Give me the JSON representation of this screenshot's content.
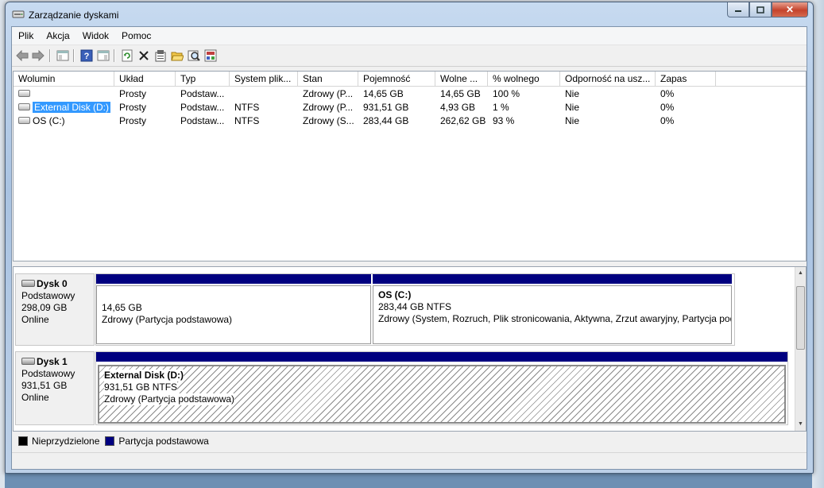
{
  "window": {
    "title": "Zarządzanie dyskami"
  },
  "menu": [
    "Plik",
    "Akcja",
    "Widok",
    "Pomoc"
  ],
  "table": {
    "columns": [
      "Wolumin",
      "Układ",
      "Typ",
      "System plik...",
      "Stan",
      "Pojemność",
      "Wolne ...",
      "% wolnego",
      "Odporność na usz...",
      "Zapas"
    ],
    "rows": [
      [
        "",
        "Prosty",
        "Podstaw...",
        "",
        "Zdrowy (P...",
        "14,65 GB",
        "14,65 GB",
        "100 %",
        "Nie",
        "0%"
      ],
      [
        "External Disk (D:)",
        "Prosty",
        "Podstaw...",
        "NTFS",
        "Zdrowy (P...",
        "931,51 GB",
        "4,93 GB",
        "1 %",
        "Nie",
        "0%"
      ],
      [
        "OS (C:)",
        "Prosty",
        "Podstaw...",
        "NTFS",
        "Zdrowy (S...",
        "283,44 GB",
        "262,62 GB",
        "93 %",
        "Nie",
        "0%"
      ]
    ]
  },
  "disks": [
    {
      "name": "Dysk 0",
      "type": "Podstawowy",
      "size": "298,09 GB",
      "status": "Online",
      "partitions": [
        {
          "title": "",
          "size": "14,65 GB",
          "status": "Zdrowy (Partycja podstawowa)"
        },
        {
          "title": "OS  (C:)",
          "size": "283,44 GB NTFS",
          "status": "Zdrowy (System, Rozruch, Plik stronicowania, Aktywna, Zrzut awaryjny, Partycja podstawowa)"
        }
      ]
    },
    {
      "name": "Dysk 1",
      "type": "Podstawowy",
      "size": "931,51 GB",
      "status": "Online",
      "partitions": [
        {
          "title": "External Disk  (D:)",
          "size": "931,51 GB NTFS",
          "status": "Zdrowy (Partycja podstawowa)"
        }
      ]
    }
  ],
  "legend": [
    {
      "label": "Nieprzydzielone",
      "color": "#000000"
    },
    {
      "label": "Partycja podstawowa",
      "color": "#000080"
    }
  ],
  "toolbar_icons": [
    "back-icon",
    "forward-icon",
    "console-tree-icon",
    "help-icon",
    "action-pane-icon",
    "refresh-icon",
    "delete-icon",
    "properties-icon",
    "open-icon",
    "explore-icon",
    "help-topics-icon"
  ]
}
